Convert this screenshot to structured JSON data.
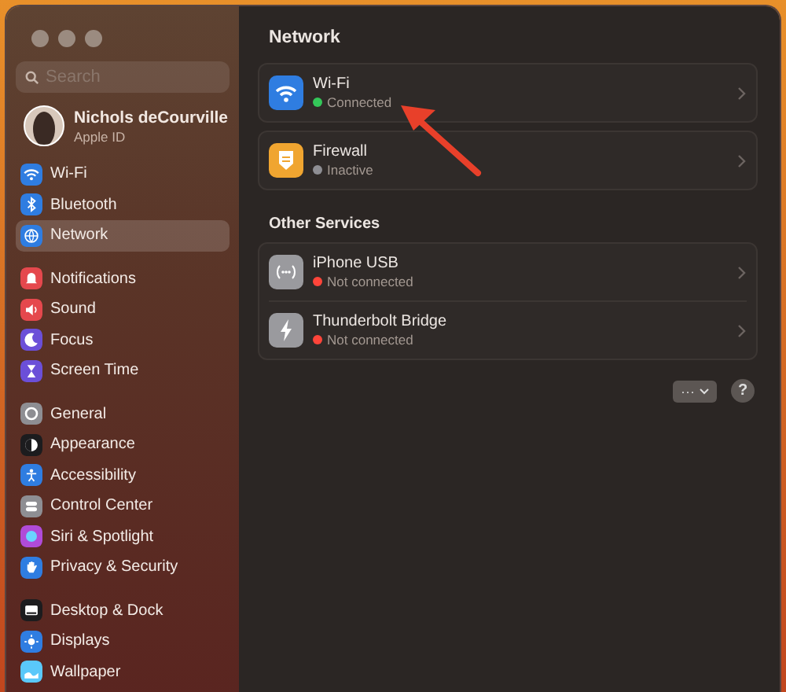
{
  "sidebar": {
    "search": {
      "placeholder": "Search"
    },
    "account": {
      "name": "Nichols deCourville",
      "subtitle": "Apple ID"
    },
    "groups": [
      [
        {
          "label": "Wi-Fi",
          "kind": "wifi",
          "color": "#2f7de1",
          "selected": false
        },
        {
          "label": "Bluetooth",
          "kind": "bluetooth",
          "color": "#2f7de1",
          "selected": false
        },
        {
          "label": "Network",
          "kind": "globe",
          "color": "#2f7de1",
          "selected": true
        }
      ],
      [
        {
          "label": "Notifications",
          "kind": "bell",
          "color": "#e5484d",
          "selected": false
        },
        {
          "label": "Sound",
          "kind": "speaker",
          "color": "#e5484d",
          "selected": false
        },
        {
          "label": "Focus",
          "kind": "moon",
          "color": "#6b4fd8",
          "selected": false
        },
        {
          "label": "Screen Time",
          "kind": "hourglass",
          "color": "#6b4fd8",
          "selected": false
        }
      ],
      [
        {
          "label": "General",
          "kind": "gear",
          "color": "#8e8e93",
          "selected": false
        },
        {
          "label": "Appearance",
          "kind": "circle",
          "color": "#1c1c1e",
          "selected": false
        },
        {
          "label": "Accessibility",
          "kind": "person",
          "color": "#2f7de1",
          "selected": false
        },
        {
          "label": "Control Center",
          "kind": "toggles",
          "color": "#8e8e93",
          "selected": false
        },
        {
          "label": "Siri & Spotlight",
          "kind": "orb",
          "color": "#b04bd8",
          "selected": false
        },
        {
          "label": "Privacy & Security",
          "kind": "hand",
          "color": "#2f7de1",
          "selected": false
        }
      ],
      [
        {
          "label": "Desktop & Dock",
          "kind": "dock",
          "color": "#1c1c1e",
          "selected": false
        },
        {
          "label": "Displays",
          "kind": "sun",
          "color": "#2f7de1",
          "selected": false
        },
        {
          "label": "Wallpaper",
          "kind": "wallpaper",
          "color": "#5ac8fa",
          "selected": false
        }
      ]
    ]
  },
  "main": {
    "title": "Network",
    "sections": [
      {
        "cards": [
          [
            {
              "name": "Wi-Fi",
              "status": "Connected",
              "color": "#34c759",
              "kind": "wifi"
            }
          ],
          [
            {
              "name": "Firewall",
              "status": "Inactive",
              "color": "#8e8e93",
              "kind": "firewall"
            }
          ]
        ]
      },
      {
        "heading": "Other Services",
        "cards": [
          [
            {
              "name": "iPhone USB",
              "status": "Not connected",
              "color": "#ff453a",
              "kind": "dots"
            },
            {
              "name": "Thunderbolt Bridge",
              "status": "Not connected",
              "color": "#ff453a",
              "kind": "bolt"
            }
          ]
        ]
      }
    ],
    "actions": {
      "more": "···",
      "help": "?"
    }
  }
}
